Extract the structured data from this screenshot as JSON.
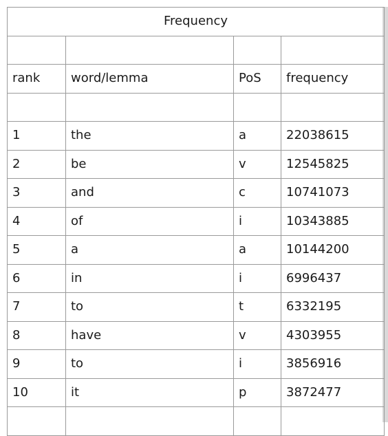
{
  "title": "Frequency",
  "headers": {
    "rank": "rank",
    "word": "word/lemma",
    "pos": "PoS",
    "frequency": "frequency"
  },
  "rows": [
    {
      "rank": "1",
      "word": "the",
      "pos": "a",
      "frequency": "22038615"
    },
    {
      "rank": "2",
      "word": "be",
      "pos": "v",
      "frequency": "12545825"
    },
    {
      "rank": "3",
      "word": "and",
      "pos": "c",
      "frequency": "10741073"
    },
    {
      "rank": "4",
      "word": "of",
      "pos": "i",
      "frequency": "10343885"
    },
    {
      "rank": "5",
      "word": "a",
      "pos": "a",
      "frequency": "10144200"
    },
    {
      "rank": "6",
      "word": "in",
      "pos": "i",
      "frequency": "6996437"
    },
    {
      "rank": "7",
      "word": "to",
      "pos": "t",
      "frequency": "6332195"
    },
    {
      "rank": "8",
      "word": "have",
      "pos": "v",
      "frequency": "4303955"
    },
    {
      "rank": "9",
      "word": "to",
      "pos": "i",
      "frequency": "3856916"
    },
    {
      "rank": "10",
      "word": "it",
      "pos": "p",
      "frequency": "3872477"
    }
  ]
}
